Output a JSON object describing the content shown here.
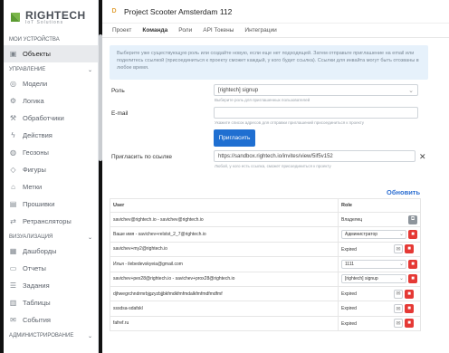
{
  "app": {
    "logo_title": "RIGHTECH",
    "logo_sub": "IoT Solutions"
  },
  "sidebar": {
    "section_devices": "МОИ УСТРОЙСТВА",
    "section_control": "УПРАВЛЕНИЕ",
    "section_viz": "ВИЗУАЛИЗАЦИЯ",
    "section_admin": "АДМИНИСТРИРОВАНИЕ",
    "items": [
      {
        "label": "Объекты"
      },
      {
        "label": "Модели"
      },
      {
        "label": "Логика"
      },
      {
        "label": "Обработчики"
      },
      {
        "label": "Действия"
      },
      {
        "label": "Геозоны"
      },
      {
        "label": "Фигуры"
      },
      {
        "label": "Метки"
      },
      {
        "label": "Прошивки"
      },
      {
        "label": "Ретрансляторы"
      },
      {
        "label": "Дашборды"
      },
      {
        "label": "Отчеты"
      },
      {
        "label": "Задания"
      },
      {
        "label": "Таблицы"
      },
      {
        "label": "События"
      }
    ]
  },
  "header": {
    "badge": "D",
    "title": "Project Scooter Amsterdam 112"
  },
  "tabs": [
    "Проект",
    "Команда",
    "Роли",
    "API Токены",
    "Интеграции"
  ],
  "info_text": "Выберите уже существующую роль или создайте новую, если еще нет подходящей. Затем отправьте приглашение на email или поделитесь ссылкой (присоединиться к проекту сможет каждый, у кого будет ссылка). Ссылки для инвайта могут быть отозваны в любое время.",
  "form": {
    "role_label": "Роль",
    "role_value": "[rightech] signup",
    "role_hint": "Выберите роль для приглашенных пользователей",
    "email_label": "E-mail",
    "email_value": "",
    "email_hint": "Укажите список адресов для отправки приглашений присоединиться к проекту",
    "invite_button": "Пригласить",
    "link_label": "Пригласить по ссылке",
    "link_value": "https://sandbox.rightech.io/invites/view/5if5v152",
    "link_hint": "Любой, у кого есть ссылка, сможет присоединиться к проекту"
  },
  "refresh_label": "Обновить",
  "table": {
    "headers": [
      "User",
      "Role"
    ],
    "rows": [
      {
        "user": "savichev@rightech.io - savichev@rightech.io",
        "role": "Владелец",
        "type": "owner"
      },
      {
        "user": "Ваше имя - savichev+relstst_2_7@rightech.io",
        "role": "Администратор",
        "type": "select"
      },
      {
        "user": "savichev+my2@rightech.io",
        "role": "Expired",
        "type": "text"
      },
      {
        "user": "Илья - ilebedevskyeia@gmail.com",
        "role": "1111",
        "type": "select"
      },
      {
        "user": "savichev+pex28@rightech.io - savichev+prox28@rightech.io",
        "role": "[rightech] signup",
        "type": "select"
      },
      {
        "user": "djhwegrchndrmrbjgzyzbjjbkfmdkfmfmdalkfmfmdfmdfmf",
        "role": "Expired",
        "type": "text"
      },
      {
        "user": "sssdsa-sdafskl",
        "role": "Expired",
        "type": "text"
      },
      {
        "user": "fafref.ru",
        "role": "Expired",
        "type": "text"
      }
    ]
  }
}
